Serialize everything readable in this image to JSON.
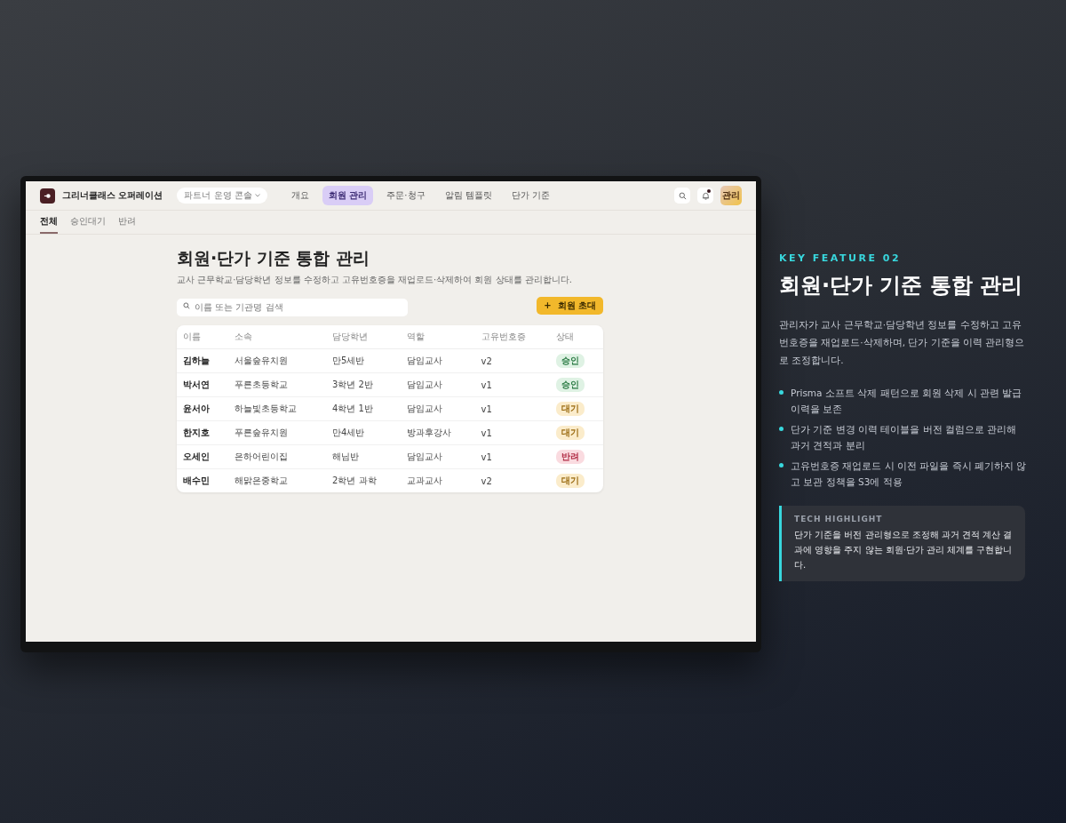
{
  "app": {
    "brand": "그리너클래스 오퍼레이션",
    "workspace": "파트너 운영 콘솔",
    "nav": [
      {
        "label": "개요",
        "selected": false
      },
      {
        "label": "회원 관리",
        "selected": true
      },
      {
        "label": "주문·청구",
        "selected": false
      },
      {
        "label": "알림 템플릿",
        "selected": false
      },
      {
        "label": "단가 기준",
        "selected": false
      }
    ],
    "notification_unread": true,
    "avatar": "관리",
    "subtabs": [
      {
        "label": "전체",
        "selected": true
      },
      {
        "label": "승인대기",
        "selected": false
      },
      {
        "label": "반려",
        "selected": false
      }
    ],
    "title": "회원·단가 기준 통합 관리",
    "description": "교사 근무학교·담당학년 정보를 수정하고 고유번호증을 재업로드·삭제하여 회원 상태를 관리합니다.",
    "search": {
      "placeholder": "이름 또는 기관명 검색"
    },
    "invite_button": {
      "icon": "+",
      "label": "회원 초대"
    },
    "table": {
      "columns": [
        "이름",
        "소속",
        "담당학년",
        "역할",
        "고유번호증",
        "상태"
      ],
      "rows": [
        {
          "name": "김하늘",
          "org": "서울숲유치원",
          "grade": "만5세반",
          "role": "담임교사",
          "doc": "v2",
          "status": "승인",
          "kind": "approved"
        },
        {
          "name": "박서연",
          "org": "푸른초등학교",
          "grade": "3학년 2반",
          "role": "담임교사",
          "doc": "v1",
          "status": "승인",
          "kind": "approved"
        },
        {
          "name": "윤서아",
          "org": "하늘빛초등학교",
          "grade": "4학년 1반",
          "role": "담임교사",
          "doc": "v1",
          "status": "대기",
          "kind": "pending"
        },
        {
          "name": "한지호",
          "org": "푸른숲유치원",
          "grade": "만4세반",
          "role": "방과후강사",
          "doc": "v1",
          "status": "대기",
          "kind": "pending"
        },
        {
          "name": "오세인",
          "org": "은하어린이집",
          "grade": "해님반",
          "role": "담임교사",
          "doc": "v1",
          "status": "반려",
          "kind": "rejected"
        },
        {
          "name": "배수민",
          "org": "해맑은중학교",
          "grade": "2학년 과학",
          "role": "교과교사",
          "doc": "v2",
          "status": "대기",
          "kind": "pending"
        }
      ]
    }
  },
  "feature": {
    "eyebrow": "KEY FEATURE 02",
    "title": "회원·단가 기준 통합 관리",
    "description": "관리자가 교사 근무학교·담당학년 정보를 수정하고 고유번호증을 재업로드·삭제하며, 단가 기준을 이력 관리형으로 조정합니다.",
    "bullets": [
      "Prisma 소프트 삭제 패턴으로 회원 삭제 시 관련 발급 이력을 보존",
      "단가 기준 변경 이력 테이블을 버전 컬럼으로 관리해 과거 견적과 분리",
      "고유번호증 재업로드 시 이전 파일을 즉시 폐기하지 않고 보관 정책을 S3에 적용"
    ],
    "highlight": {
      "label": "TECH HIGHLIGHT",
      "text": "단가 기준을 버전 관리형으로 조정해 과거 견적 계산 결과에 영향을 주지 않는 회원·단가 관리 체계를 구현합니다."
    }
  }
}
